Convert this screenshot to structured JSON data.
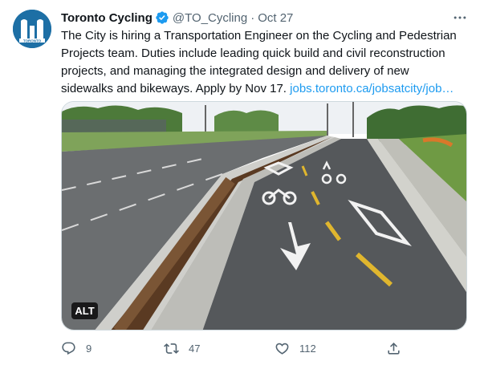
{
  "author": {
    "display_name": "Toronto Cycling",
    "handle": "@TO_Cycling",
    "separator": "·",
    "timestamp": "Oct 27",
    "avatar_text": "TORONTO",
    "verified_color": "#1d9bf0"
  },
  "tweet": {
    "text": "The City is hiring a Transportation Engineer on the Cycling and Pedestrian Projects team. Duties include leading quick build and civil reconstruction projects, and managing the integrated design and delivery of new sidewalks and bikeways. Apply by Nov 17. ",
    "link_text": "jobs.toronto.ca/jobsatcity/job…",
    "link_color": "#1d9bf0"
  },
  "media": {
    "alt_label": "ALT"
  },
  "actions": {
    "reply_count": "9",
    "retweet_count": "47",
    "like_count": "112"
  },
  "icons": {
    "more": "more-icon",
    "reply": "reply-icon",
    "retweet": "retweet-icon",
    "like": "heart-icon",
    "share": "share-icon",
    "verified": "verified-badge-icon"
  }
}
